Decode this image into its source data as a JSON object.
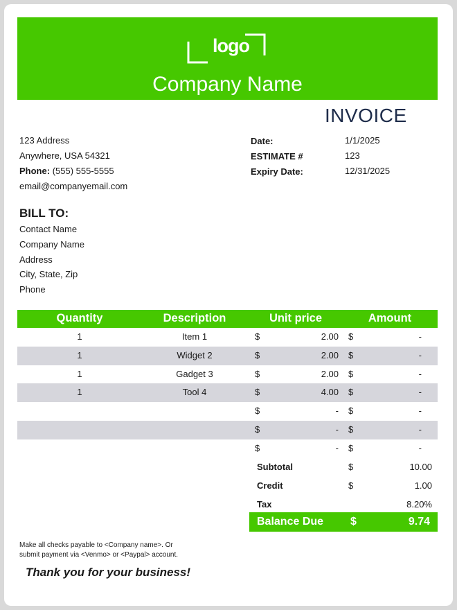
{
  "header": {
    "logo_text": "logo",
    "company_name": "Company Name",
    "brand_color": "#46c800",
    "title": "INVOICE"
  },
  "company_info": {
    "address": "123 Address",
    "city_line": "Anywhere, USA 54321",
    "phone_label": "Phone:",
    "phone_value": "(555) 555-5555",
    "email": "email@companyemail.com"
  },
  "meta": [
    {
      "label": "Date:",
      "value": "1/1/2025"
    },
    {
      "label": "ESTIMATE #",
      "value": "123"
    },
    {
      "label": "Expiry Date:",
      "value": "12/31/2025"
    }
  ],
  "bill_to": {
    "heading": "BILL TO:",
    "lines": [
      "Contact Name",
      "Company Name",
      "Address",
      "City, State, Zip",
      "Phone"
    ]
  },
  "table": {
    "headers": [
      "Quantity",
      "Description",
      "Unit price",
      "Amount"
    ],
    "rows": [
      {
        "qty": "1",
        "desc": "Item 1",
        "dollar1": "$",
        "unit": "2.00",
        "dollar2": "$",
        "amount": "-"
      },
      {
        "qty": "1",
        "desc": "Widget 2",
        "dollar1": "$",
        "unit": "2.00",
        "dollar2": "$",
        "amount": "-"
      },
      {
        "qty": "1",
        "desc": "Gadget 3",
        "dollar1": "$",
        "unit": "2.00",
        "dollar2": "$",
        "amount": "-"
      },
      {
        "qty": "1",
        "desc": "Tool 4",
        "dollar1": "$",
        "unit": "4.00",
        "dollar2": "$",
        "amount": "-"
      },
      {
        "qty": "",
        "desc": "",
        "dollar1": "$",
        "unit": "-",
        "dollar2": "$",
        "amount": "-"
      },
      {
        "qty": "",
        "desc": "",
        "dollar1": "$",
        "unit": "-",
        "dollar2": "$",
        "amount": "-"
      },
      {
        "qty": "",
        "desc": "",
        "dollar1": "$",
        "unit": "-",
        "dollar2": "$",
        "amount": "-"
      }
    ]
  },
  "totals": [
    {
      "label": "Subtotal",
      "dollar": "$",
      "value": "10.00"
    },
    {
      "label": "Credit",
      "dollar": "$",
      "value": "1.00"
    },
    {
      "label": "Tax",
      "dollar": "",
      "value": "8.20%"
    }
  ],
  "balance_due": {
    "label": "Balance Due",
    "dollar": "$",
    "value": "9.74"
  },
  "footer": {
    "note_line1": "Make all checks payable to <Company name>. Or",
    "note_line2": "submit payment  via  <Venmo> or <Paypal> account.",
    "thanks": "Thank you for your business!"
  }
}
